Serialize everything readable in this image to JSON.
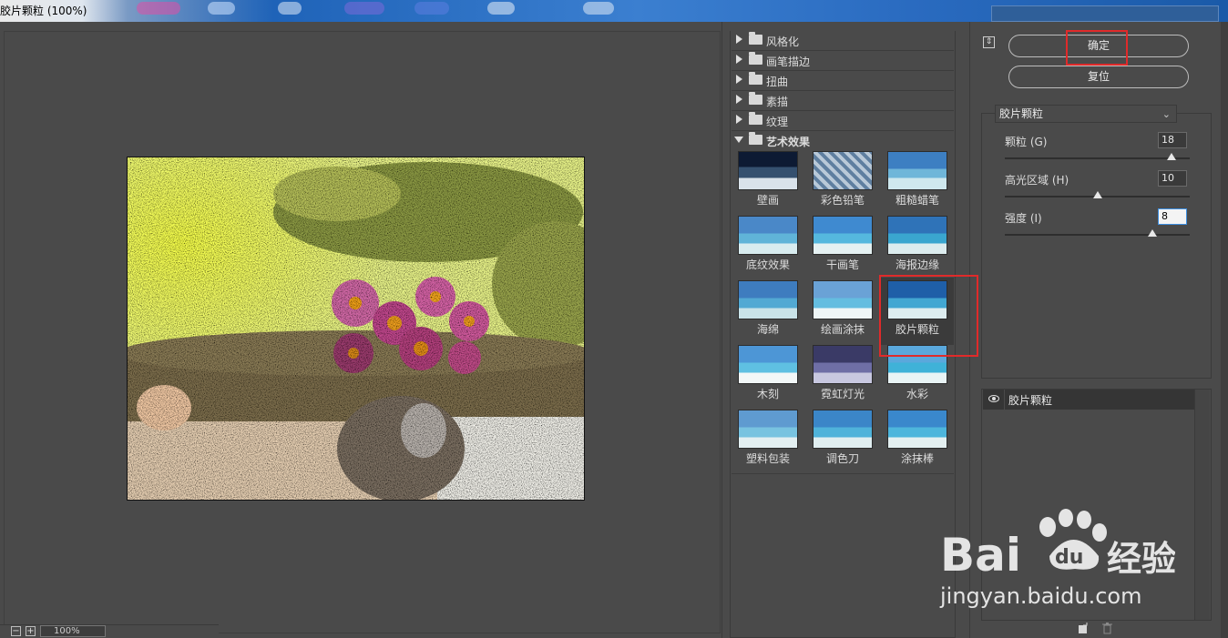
{
  "window": {
    "title": "胶片颗粒 (100%)",
    "right_title": "",
    "colors": {
      "panel_bg": "#4a4a4a",
      "highlight": "#e02a2a",
      "title_blue": "#1f63b8"
    }
  },
  "preview": {
    "zoom": "100%",
    "zoom_out_icon": "minus-icon",
    "zoom_in_icon": "plus-icon"
  },
  "gallery": {
    "categories": [
      {
        "label": "风格化",
        "open": false
      },
      {
        "label": "画笔描边",
        "open": false
      },
      {
        "label": "扭曲",
        "open": false
      },
      {
        "label": "素描",
        "open": false
      },
      {
        "label": "纹理",
        "open": false
      },
      {
        "label": "艺术效果",
        "open": true
      }
    ],
    "filters": [
      {
        "label": "壁画"
      },
      {
        "label": "彩色铅笔"
      },
      {
        "label": "粗糙蜡笔"
      },
      {
        "label": "底纹效果"
      },
      {
        "label": "干画笔"
      },
      {
        "label": "海报边缘"
      },
      {
        "label": "海绵"
      },
      {
        "label": "绘画涂抹"
      },
      {
        "label": "胶片颗粒",
        "selected": true
      },
      {
        "label": "木刻"
      },
      {
        "label": "霓虹灯光"
      },
      {
        "label": "水彩"
      },
      {
        "label": "塑料包装"
      },
      {
        "label": "调色刀"
      },
      {
        "label": "涂抹棒"
      }
    ]
  },
  "actions": {
    "ok_label": "确定",
    "reset_label": "复位"
  },
  "settings": {
    "filter_select": "胶片颗粒",
    "params": [
      {
        "label": "颗粒 (G)",
        "value": "18",
        "level": 0.9
      },
      {
        "label": "高光区域 (H)",
        "value": "10",
        "level": 0.5
      },
      {
        "label": "强度 (I)",
        "value": "8",
        "level": 0.8
      }
    ]
  },
  "layers": {
    "items": [
      {
        "label": "胶片颗粒",
        "visible": true
      }
    ],
    "new_layer_icon": "new-layer-icon",
    "delete_icon": "trash-icon"
  },
  "watermark": {
    "brand": "Bai",
    "brand_du": "du",
    "brand_cn": "经验",
    "url": "jingyan.baidu.com"
  }
}
